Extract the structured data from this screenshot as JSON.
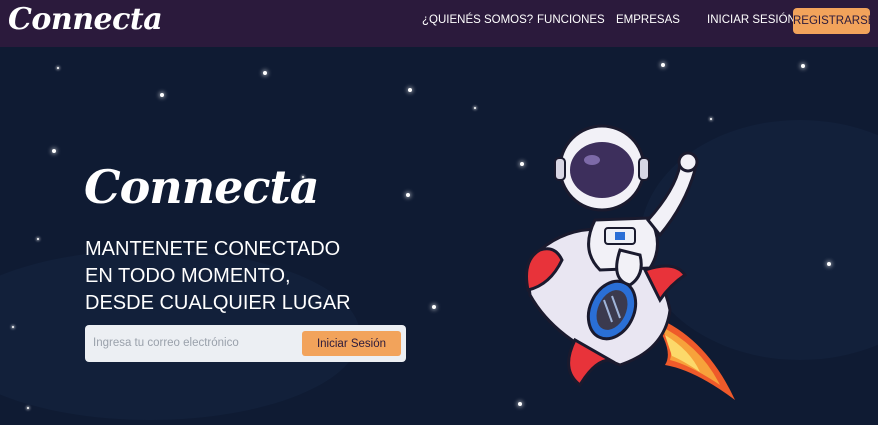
{
  "navbar": {
    "brand": "Connecta",
    "links": {
      "quienes": "¿QUIENÉS SOMOS?",
      "funciones": "FUNCIONES",
      "empresas": "EMPRESAS",
      "login": "INICIAR SESIÓN"
    },
    "register_label": "REGISTRARSE"
  },
  "hero": {
    "title": "Connecta",
    "tagline": [
      "MANTENETE CONECTADO",
      "EN TODO MOMENTO,",
      "DESDE CUALQUIER LUGAR"
    ],
    "form": {
      "email_placeholder": "Ingresa tu correo electrónico",
      "email_value": "",
      "submit_label": "Iniciar Sesión"
    },
    "illustration": "astronaut-riding-rocket"
  },
  "colors": {
    "navbar_bg": "#2b1a3c",
    "hero_bg": "#0f1b33",
    "accent": "#f2a35b",
    "text": "#ffffff"
  }
}
